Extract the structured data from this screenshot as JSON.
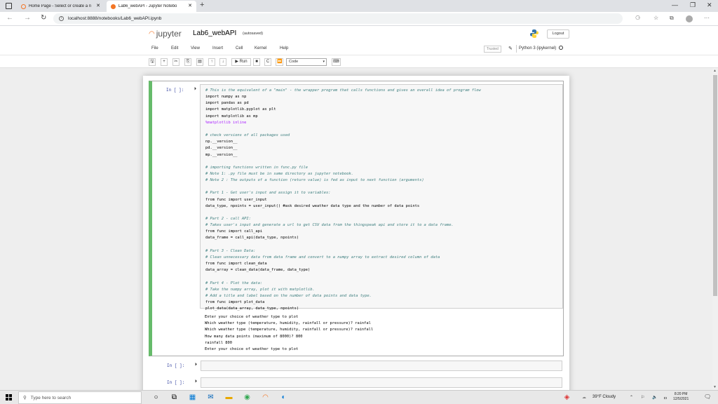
{
  "browser": {
    "tabs": [
      {
        "title": "Home Page - Select or create a n",
        "color": "#f37626"
      },
      {
        "title": "Lab6_webAPI - Jupyter Notebo",
        "color": "#f37626"
      }
    ],
    "url": "localhost:8888/notebooks/Lab6_webAPI.ipynb"
  },
  "jupyter": {
    "logo_text": "jupyter",
    "notebook_name": "Lab6_webAPI",
    "save_status": "(autosaved)",
    "logout_label": "Logout",
    "menu": [
      "File",
      "Edit",
      "View",
      "Insert",
      "Cell",
      "Kernel",
      "Help"
    ],
    "trusted_label": "Trusted",
    "kernel_label": "Python 3 (ipykernel)",
    "run_label": "Run",
    "cell_type": "Code"
  },
  "cells": {
    "prompt": "In [ ]:",
    "code": [
      "# This is the equivalent of a \"main\" - the wrapper program that calls functions and gives an overall idea of program flow",
      "import numpy as np",
      "import pandas as pd",
      "import matplotlib.pyplot as plt",
      "import matplotlib as mp",
      "%matplotlib inline",
      "",
      "# check versions of all packages used",
      "np.__version__",
      "pd.__version__",
      "mp.__version__",
      "",
      "# importing functions written in func.py file",
      "# Note 1: .py file must be in same directory as jupyter notebook.",
      "# Note 2 : The outputs of a function (return value) is fed as input to next function (arguments)",
      "",
      "# Part 1 - Get user's input and assign it to variables:",
      "from func import user_input",
      "data_type, npoints = user_input() #ask desired weather data type and the number of data points",
      "",
      "# Part 2 - call API:",
      "# Takes user's input and generate a url to get CSV data from the thingspeak api and store it to a data frame.",
      "from func import call_api",
      "data_frame = call_api(data_type, npoints)",
      "",
      "# Part 3 - Clean Data:",
      "# Clean unnecessary data from data frame and convert to a numpy array to extract desired column of data",
      "from func import clean_data",
      "data_array = clean_data(data_frame, data_type)",
      "",
      "# Part 4 - Plot the data:",
      "# Take the numpy array, plot it with matplotlib.",
      "# Add a title and label based on the number of data points and data type.",
      "from func import plot_data",
      "plot_data(data_array, data_type, npoints)"
    ],
    "output": [
      "Enter your choice of weather type to plot",
      "Which weather type (temperature, humidity, rainfall or pressure)? rainfal",
      "Which weather type (temperature, humidity, rainfall or pressure)? rainfall",
      "How many data points (maximum of 8000)? 800",
      "rainfall 800",
      "Enter your choice of weather type to plot"
    ]
  },
  "taskbar": {
    "search_placeholder": "Type here to search",
    "weather": "39°F  Cloudy",
    "time": "8:20 PM",
    "date": "12/5/2021"
  }
}
